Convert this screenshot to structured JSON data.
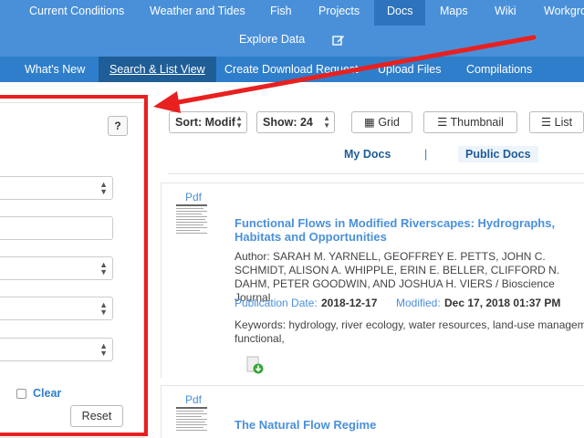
{
  "topnav": {
    "row1": [
      "Current Conditions",
      "Weather and Tides",
      "Fish",
      "Projects",
      "Docs",
      "Maps",
      "Wiki",
      "Workgro"
    ],
    "active": "Docs",
    "explore": "Explore Data",
    "edit_icon": "pencil-square-icon"
  },
  "subnav": {
    "items": [
      "What's New",
      "Search & List View",
      "Create Download Request",
      "Upload Files",
      "Compilations"
    ],
    "active": "Search & List View"
  },
  "filters": {
    "help": "?",
    "clear": "Clear",
    "reset": "Reset"
  },
  "toolbar": {
    "sort": "Sort: Modif",
    "show": "Show: 24",
    "grid": "Grid",
    "thumbnail": "Thumbnail",
    "list": "List"
  },
  "tabs": {
    "my_docs": "My Docs",
    "separator": "|",
    "public_docs": "Public Docs"
  },
  "docs": [
    {
      "type": "Pdf",
      "title": "Functional Flows in Modified Riverscapes: Hydrographs, Habitats and Opportunities",
      "author": "Author: SARAH M. YARNELL, GEOFFREY E. PETTS, JOHN C. SCHMIDT, ALISON A. WHIPPLE, ERIN E. BELLER, CLIFFORD N. DAHM, PETER GOODWIN, AND JOSHUA H. VIERS / Bioscience Journal",
      "pub_date_label": "Publication Date:",
      "pub_date": "2018-12-17",
      "modified_label": "Modified:",
      "modified": "Dec 17, 2018 01:37 PM",
      "keywords_line1": "Keywords: hydrology, river ecology, water resources, land-use managem",
      "keywords_line2": "functional,"
    },
    {
      "type": "Pdf",
      "title": "The Natural Flow Regime"
    }
  ],
  "colors": {
    "topnav": "#4a90d9",
    "subnav": "#2f7ecb",
    "active": "#1f5d96",
    "link": "#4a90d9",
    "annotation": "#e8201f"
  }
}
